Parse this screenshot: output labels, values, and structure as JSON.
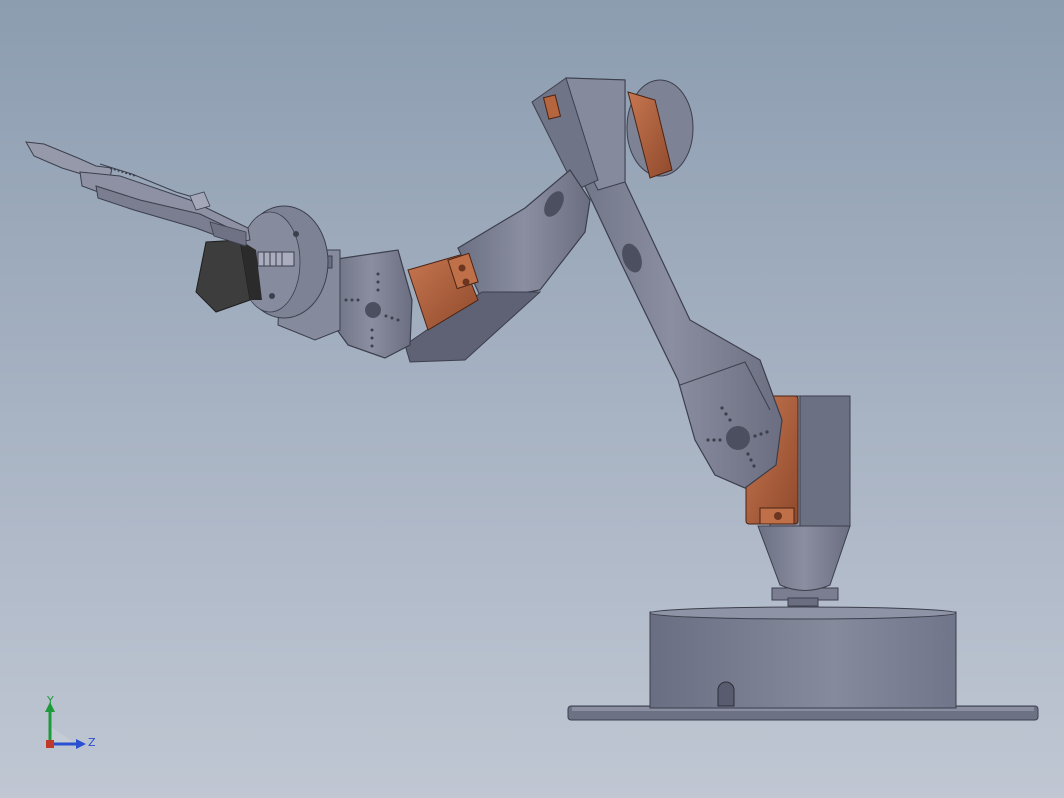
{
  "viewport": {
    "background_top": "#8c9db0",
    "background_bottom": "#c0c7d3"
  },
  "model": {
    "part_color": "#777b8d",
    "part_dark": "#55586a",
    "servo_color": "#b0603a",
    "motor_color": "#3d3d3d"
  },
  "triad": {
    "y_label": "Y",
    "z_label": "Z",
    "y_color": "#1f9a3a",
    "z_color": "#2a4fd0"
  }
}
